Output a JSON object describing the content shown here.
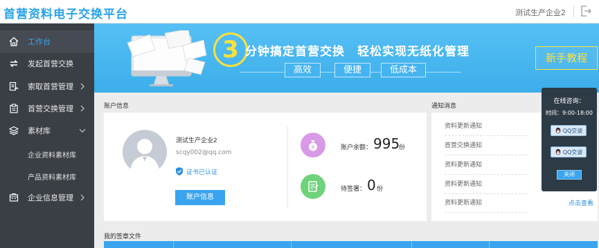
{
  "header": {
    "app_title": "首营资料电子交换平台",
    "company_name": "测试生产企业2",
    "logout_icon": "logout-icon"
  },
  "sidebar": {
    "items": [
      {
        "label": "工作台",
        "icon": "home-icon",
        "active": true
      },
      {
        "label": "发起首营交换",
        "icon": "exchange-icon"
      },
      {
        "label": "索取首营管理",
        "icon": "request-doc-icon",
        "has_arrow": true
      },
      {
        "label": "首营交换管理",
        "icon": "clipboard-icon",
        "has_arrow": true
      },
      {
        "label": "素材库",
        "icon": "layers-icon",
        "expanded": true
      },
      {
        "label": "企业信息管理",
        "icon": "building-icon",
        "has_arrow": true
      }
    ],
    "sub_items": [
      {
        "label": "企业资料素材库"
      },
      {
        "label": "产品资料素材库"
      }
    ]
  },
  "banner": {
    "number": "3",
    "slogan": "分钟搞定首营交换　轻松实现无纸化管理",
    "tags": [
      "高效",
      "便捷",
      "低成本"
    ],
    "guide_button": "新手教程"
  },
  "account": {
    "section_title": "账户信息",
    "name": "测试生产企业2",
    "email": "scqy002@qq.com",
    "cert_status": "证书已认证",
    "button_label": "账户信息",
    "balance_label": "账户余额：",
    "balance_value": "995",
    "balance_unit": "份",
    "pending_label": "待签署：",
    "pending_value": "0",
    "pending_unit": "份"
  },
  "notices": {
    "section_title": "通知消息",
    "items": [
      "资料更新通知",
      "首营交换通知",
      "资料更新通知",
      "资料更新通知",
      "资料更新通知"
    ],
    "see_more": "点击查看"
  },
  "consult": {
    "title": "在线咨询：",
    "hours": "时间：9:00-18:00",
    "qq_label": "QQ交谈",
    "close_label": "关闭"
  },
  "signed_files": {
    "section_title": "我的签章文件"
  },
  "colors": {
    "accent": "#3aa4ef",
    "sidebar_bg": "#3a3e45",
    "banner_bg": "#45b4f0",
    "highlight_yellow": "#ffe13a"
  }
}
